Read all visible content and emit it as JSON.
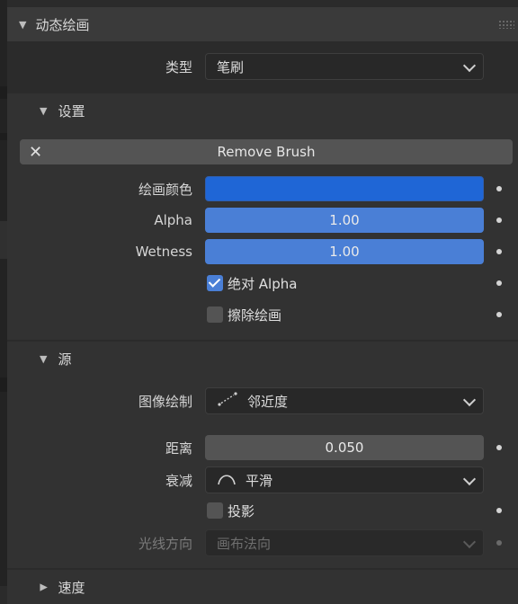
{
  "panel": {
    "title": "动态绘画"
  },
  "type_row": {
    "label": "类型",
    "value": "笔刷"
  },
  "settings": {
    "title": "设置",
    "remove_brush": "Remove Brush",
    "paint_color_label": "绘画颜色",
    "paint_color": "#1f66d6",
    "alpha_label": "Alpha",
    "alpha_value": "1.00",
    "wetness_label": "Wetness",
    "wetness_value": "1.00",
    "absolute_alpha_label": "绝对 Alpha",
    "absolute_alpha_checked": true,
    "erase_paint_label": "擦除绘画",
    "erase_paint_checked": false
  },
  "source": {
    "title": "源",
    "paint_source_label": "图像绘制",
    "paint_source_value": "邻近度",
    "distance_label": "距离",
    "distance_value": "0.050",
    "falloff_label": "衰减",
    "falloff_value": "平滑",
    "project_label": "投影",
    "project_checked": false,
    "ray_direction_label": "光线方向",
    "ray_direction_value": "画布法向"
  },
  "next_section": {
    "title": "速度"
  },
  "colors": {
    "accent": "#4a7fd6",
    "button": "#545454",
    "background": "#2b2b2b"
  }
}
